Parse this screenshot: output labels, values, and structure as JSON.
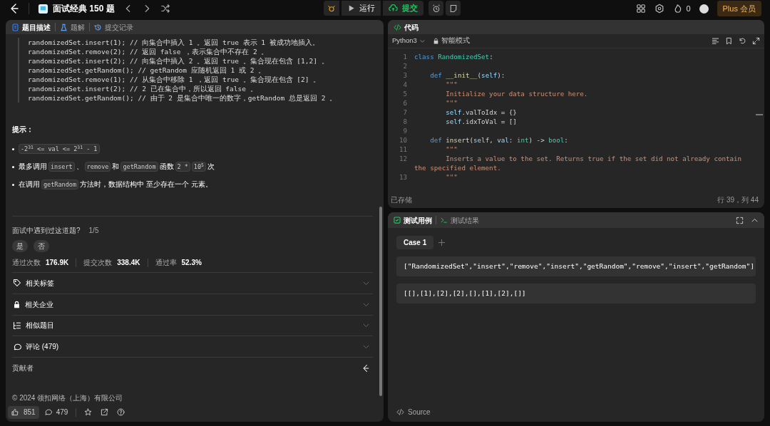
{
  "topbar": {
    "title": "面试经典 150 题",
    "run": "运行",
    "submit": "提交",
    "streak": "0",
    "plus": "Plus 会员"
  },
  "left": {
    "tabs": [
      {
        "label": "题目描述",
        "selected": true
      },
      {
        "label": "题解",
        "selected": false
      },
      {
        "label": "提交记录",
        "selected": false
      }
    ],
    "example_lines": [
      "randomizedSet.insert(1); // 向集合中插入 1 。返回 true 表示 1 被成功地插入。",
      "randomizedSet.remove(2); // 返回 false ，表示集合中不存在 2 。",
      "randomizedSet.insert(2); // 向集合中插入 2 。返回 true 。集合现在包含 [1,2] 。",
      "randomizedSet.getRandom(); // getRandom 应随机返回 1 或 2 。",
      "randomizedSet.remove(1); // 从集合中移除 1 ，返回 true 。集合现在包含 [2] 。",
      "randomizedSet.insert(2); // 2 已在集合中，所以返回 false 。",
      "randomizedSet.getRandom(); // 由于 2 是集合中唯一的数字，getRandom 总是返回 2 。"
    ],
    "hints_title": "提示：",
    "hints": [
      [
        {
          "text": "-2$^{31}$ <= val <= 2$^{31}$ - 1",
          "kind": "code"
        }
      ],
      [
        {
          "text": "最多调用",
          "kind": "text"
        },
        {
          "text": "insert",
          "kind": "code"
        },
        {
          "text": "、",
          "kind": "text"
        },
        {
          "text": "remove",
          "kind": "code"
        },
        {
          "text": "和",
          "kind": "text"
        },
        {
          "text": "getRandom",
          "kind": "code"
        },
        {
          "text": "函数",
          "kind": "text"
        },
        {
          "text": "2 *",
          "kind": "code"
        },
        {
          "text": "10$^{5}$",
          "kind": "code"
        },
        {
          "text": "次",
          "kind": "text"
        }
      ],
      [
        {
          "text": "在调用",
          "kind": "text"
        },
        {
          "text": "getRandom",
          "kind": "code"
        },
        {
          "text": "方法时，数据结构中 至少存在一个 元素。",
          "kind": "text"
        }
      ]
    ],
    "interview": {
      "question": "面试中遇到过这道题?",
      "count": "1/5",
      "options": [
        "是",
        "否"
      ]
    },
    "stats": [
      {
        "label": "通过次数",
        "value": "176.9K"
      },
      {
        "label": "提交次数",
        "value": "338.4K"
      },
      {
        "label": "通过率",
        "value": "52.3%"
      }
    ],
    "sections": [
      {
        "kind": "tag",
        "label": "相关标签"
      },
      {
        "kind": "lock",
        "label": "相关企业"
      },
      {
        "kind": "list",
        "label": "相似题目"
      },
      {
        "kind": "comment",
        "label": "评论 (479)"
      }
    ],
    "contributors": "贡献者",
    "copyright": "© 2024 领扣网络（上海）有限公司",
    "footer": {
      "likes": "851",
      "comments": "479"
    }
  },
  "editor": {
    "title": "代码",
    "language": "Python3",
    "mode": "智能模式",
    "lines": [
      {
        "n": "1",
        "tokens": [
          {
            "t": "class ",
            "kind": "keyword"
          },
          {
            "t": "RandomizedSet",
            "kind": "type"
          },
          {
            "t": ":",
            "kind": "plain"
          }
        ]
      },
      {
        "n": "2"
      },
      {
        "n": "3",
        "tokens": [
          {
            "t": "    def ",
            "kind": "keyword"
          },
          {
            "t": "__init__",
            "kind": "function"
          },
          {
            "t": "(",
            "kind": "plain"
          },
          {
            "t": "self",
            "kind": "variable"
          },
          {
            "t": "):",
            "kind": "plain"
          }
        ]
      },
      {
        "n": "4",
        "tokens": [
          {
            "t": "        \"\"\"",
            "kind": "string"
          }
        ]
      },
      {
        "n": "5",
        "tokens": [
          {
            "t": "        Initialize your data structure here.",
            "kind": "string"
          }
        ]
      },
      {
        "n": "6",
        "tokens": [
          {
            "t": "        \"\"\"",
            "kind": "string"
          }
        ]
      },
      {
        "n": "7",
        "tokens": [
          {
            "t": "        self",
            "kind": "variable"
          },
          {
            "t": ".valToIdx = {}",
            "kind": "plain"
          }
        ]
      },
      {
        "n": "8",
        "tokens": [
          {
            "t": "        self",
            "kind": "variable"
          },
          {
            "t": ".idxToVal = []",
            "kind": "plain"
          }
        ]
      },
      {
        "n": "9"
      },
      {
        "n": "10",
        "tokens": [
          {
            "t": "    def ",
            "kind": "keyword"
          },
          {
            "t": "insert",
            "kind": "function"
          },
          {
            "t": "(",
            "kind": "plain"
          },
          {
            "t": "self",
            "kind": "variable"
          },
          {
            "t": ", ",
            "kind": "plain"
          },
          {
            "t": "val",
            "kind": "variable"
          },
          {
            "t": ": ",
            "kind": "plain"
          },
          {
            "t": "int",
            "kind": "type"
          },
          {
            "t": ") -> ",
            "kind": "plain"
          },
          {
            "t": "bool",
            "kind": "type"
          },
          {
            "t": ":",
            "kind": "plain"
          }
        ]
      },
      {
        "n": "11",
        "tokens": [
          {
            "t": "        \"\"\"",
            "kind": "string"
          }
        ]
      },
      {
        "n": "12",
        "tokens": [
          {
            "t": "        Inserts a value to the set. Returns true if the set did not already contain the specified element.",
            "kind": "string"
          }
        ]
      },
      {
        "n": "13",
        "tokens": [
          {
            "t": "        \"\"\"",
            "kind": "string"
          }
        ]
      }
    ],
    "saved": "已存储",
    "cursor": "行 39，列 44"
  },
  "tests": {
    "tabs": [
      {
        "label": "测试用例",
        "selected": true
      },
      {
        "label": "测试结果",
        "selected": false
      }
    ],
    "case": "Case 1",
    "inputs": [
      "[\"RandomizedSet\",\"insert\",\"remove\",\"insert\",\"getRandom\",\"remove\",\"insert\",\"getRandom\"]",
      "[[],[1],[2],[2],[],[1],[2],[]]"
    ],
    "source": "Source"
  }
}
